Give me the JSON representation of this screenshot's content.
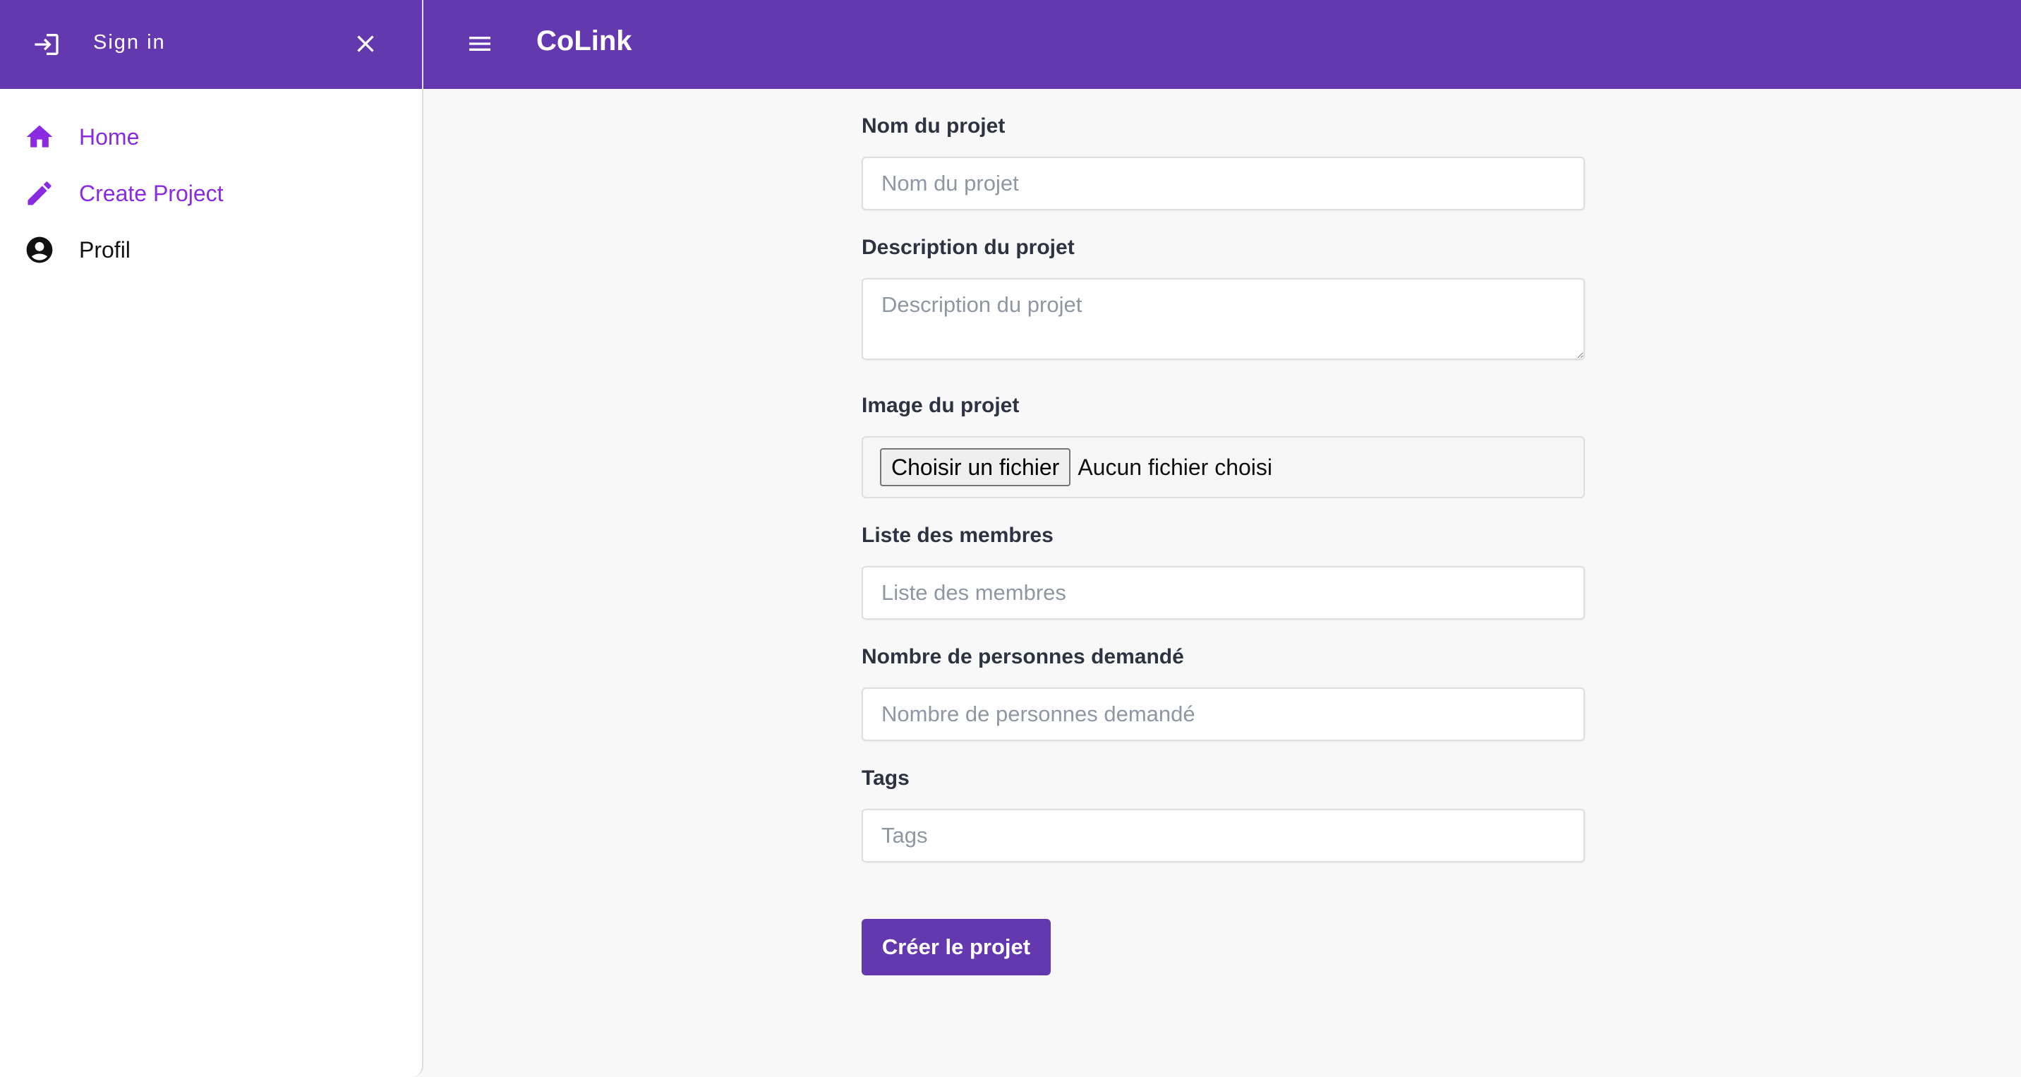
{
  "sidebar": {
    "header": {
      "signin_label": "Sign in"
    },
    "items": [
      {
        "label": "Home",
        "icon": "home-icon",
        "active": true
      },
      {
        "label": "Create Project",
        "icon": "pencil-icon",
        "active": true
      },
      {
        "label": "Profil",
        "icon": "account-circle-icon",
        "active": false
      }
    ]
  },
  "topbar": {
    "title": "CoLink"
  },
  "form": {
    "name": {
      "label": "Nom du projet",
      "placeholder": "Nom du projet"
    },
    "description": {
      "label": "Description du projet",
      "placeholder": "Description du projet"
    },
    "image": {
      "label": "Image du projet",
      "button": "Choisir un fichier",
      "status": "Aucun fichier choisi"
    },
    "members": {
      "label": "Liste des membres",
      "placeholder": "Liste des membres"
    },
    "count": {
      "label": "Nombre de personnes demandé",
      "placeholder": "Nombre de personnes demandé"
    },
    "tags": {
      "label": "Tags",
      "placeholder": "Tags"
    },
    "submit_label": "Créer le projet"
  },
  "colors": {
    "brand": "#6439b0",
    "nav_active": "#8a2be2",
    "background": "#f8f8f9"
  }
}
